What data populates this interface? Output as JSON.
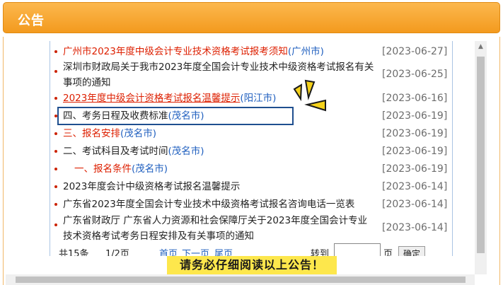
{
  "header": {
    "title": "公告"
  },
  "announcements": [
    {
      "title": "广州市2023年度中级会计专业技术资格考试报考须知",
      "city": "(广州市)",
      "date": "[2023-06-27]"
    },
    {
      "title": "深圳市财政局关于我市2023年度全国会计专业技术中级资格考试报名有关事项的通知",
      "city": "",
      "date": "[2023-06-25]"
    },
    {
      "title": "2023年度中级会计资格考试报名温馨提示",
      "city": "(阳江市)",
      "date": "[2023-06-16]"
    },
    {
      "title": "四、考务日程及收费标准",
      "city": "(茂名市)",
      "date": "[2023-06-19]"
    },
    {
      "title": "三、报名安排",
      "city": "(茂名市)",
      "date": "[2023-06-19]"
    },
    {
      "title": "二、考试科目及考试时间",
      "city": "(茂名市)",
      "date": "[2023-06-19]"
    },
    {
      "title": "一、报名条件",
      "city": "(茂名市)",
      "date": "[2023-06-19]"
    },
    {
      "title": "2023年度会计中级资格考试报名温馨提示",
      "city": "",
      "date": "[2023-06-14]"
    },
    {
      "title": "广东省2023年度全国会计专业技术中级资格考试报名咨询电话一览表",
      "city": "",
      "date": "[2023-06-14]"
    },
    {
      "title": "广东省财政厅 广东省人力资源和社会保障厅关于2023年度全国会计专业技术资格考试考务日程安排及有关事项的通知",
      "city": "",
      "date": "[2023-06-14]"
    }
  ],
  "pagination": {
    "total": "共15条",
    "page": "1/2页",
    "first": "首页",
    "next": "下一页",
    "last": "尾页",
    "goto_label": "转到",
    "page_unit": "页",
    "confirm": "确定"
  },
  "notice": "请务必仔细阅读以上公告！",
  "colors": {
    "header": "#f5a12a",
    "red_text": "#dd1f00",
    "city_link": "#1f5fbf",
    "banner": "#fde74c"
  }
}
